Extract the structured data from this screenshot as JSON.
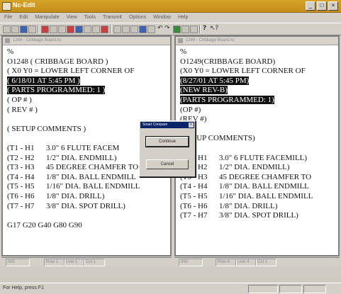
{
  "app": {
    "title": "Nc-Edit",
    "menu": [
      "File",
      "Edit",
      "Manipulate",
      "View",
      "Tools",
      "Transmit",
      "Options",
      "Window",
      "Help"
    ]
  },
  "left_pane": {
    "title": "1248 - Cribbage Board.nc",
    "lines": [
      {
        "text": "%",
        "highlight": false
      },
      {
        "text": "O1248 ( CRIBBAGE BOARD )",
        "highlight": false
      },
      {
        "text": "( X0 Y0 = LOWER LEFT CORNER OF",
        "highlight": false
      },
      {
        "text": "( 6/18/01 AT 5:45 PM )",
        "highlight": true
      },
      {
        "text": "( PARTS PROGRAMMED: 1 )",
        "highlight": true
      },
      {
        "text": "( OP # )",
        "highlight": false
      },
      {
        "text": "( REV # )",
        "highlight": false
      },
      {
        "text": "",
        "highlight": false
      },
      {
        "text": "( SETUP COMMENTS )",
        "highlight": false
      },
      {
        "text": "",
        "highlight": false
      },
      {
        "text": "(T1 - H1      3.0\" 6 FLUTE FACEM",
        "highlight": false
      },
      {
        "text": "(T2 - H2      1/2\" DIA. ENDMILL)",
        "highlight": false
      },
      {
        "text": "(T3 - H3      45 DEGREE CHAMFER TO",
        "highlight": false
      },
      {
        "text": "(T4 - H4      1/8\" DIA. BALL ENDMILL",
        "highlight": false
      },
      {
        "text": "(T5 - H5      1/16\" DIA. BALL ENDMILL",
        "highlight": false
      },
      {
        "text": "(T6 - H6      1/8\" DIA. DRILL)",
        "highlight": false
      },
      {
        "text": "(T7 - H7      3/8\" DIA. SPOT DRILL)",
        "highlight": false
      },
      {
        "text": "",
        "highlight": false
      },
      {
        "text": "G17 G20 G40 G80 G90",
        "highlight": false
      }
    ],
    "status": [
      "INS",
      "Row 1",
      "Line 1",
      "Col 1"
    ]
  },
  "right_pane": {
    "title": "1249 - Cribbage Board.nc",
    "lines": [
      {
        "text": "%",
        "highlight": false
      },
      {
        "text": "O1249(CRIBBAGE BOARD)",
        "highlight": false
      },
      {
        "text": "(X0 Y0 = LOWER LEFT CORNER OF",
        "highlight": false
      },
      {
        "text": "(8/27/01 AT 5:45 PM)",
        "highlight": true
      },
      {
        "text": "(NEW REV-B)",
        "highlight": true
      },
      {
        "text": "(PARTS PROGRAMMED: 1)",
        "highlight": true
      },
      {
        "text": "(OP #)",
        "highlight": false
      },
      {
        "text": "(REV #)",
        "highlight": false
      },
      {
        "text": "",
        "highlight": false
      },
      {
        "text": "(SETUP COMMENTS)",
        "highlight": false
      },
      {
        "text": "",
        "highlight": false
      },
      {
        "text": "(T1 - H1      3.0\" 6 FLUTE FACEMILL)",
        "highlight": false
      },
      {
        "text": "(T2 - H2      1/2\" DIA. ENDMILL)",
        "highlight": false
      },
      {
        "text": "(T3 - H3      45 DEGREE CHAMFER TO",
        "highlight": false
      },
      {
        "text": "(T4 - H4      1/8\" DIA. BALL ENDMILL",
        "highlight": false
      },
      {
        "text": "(T5 - H5      1/16\" DIA. BALL ENDMILL",
        "highlight": false
      },
      {
        "text": "(T6 - H6      1/8\" DIA. DRILL)",
        "highlight": false
      },
      {
        "text": "(T7 - H7      3/8\" DIA. SPOT DRILL)",
        "highlight": false
      }
    ],
    "status": [
      "INS",
      "Row 4",
      "Line 4",
      "Col 1"
    ]
  },
  "dialog": {
    "title": "Smart Compare",
    "continue_label": "Continue",
    "cancel_label": "Cancel"
  },
  "statusbar": {
    "help_text": "For Help, press F1"
  },
  "colors": {
    "title_bar": "#c8961e",
    "highlight_bg": "#111111",
    "dialog_title": "#0a246a"
  }
}
